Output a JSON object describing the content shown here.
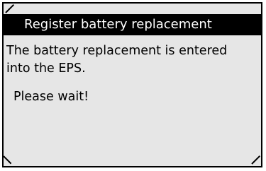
{
  "dialog": {
    "title": "Register battery replacement",
    "message_lines": [
      "The battery replacement is entered",
      "into the EPS."
    ],
    "status": "Please wait!"
  },
  "colors": {
    "title_background": "#000000",
    "title_text": "#ffffff",
    "screen_background": "#e6e6e6",
    "text": "#000000"
  }
}
